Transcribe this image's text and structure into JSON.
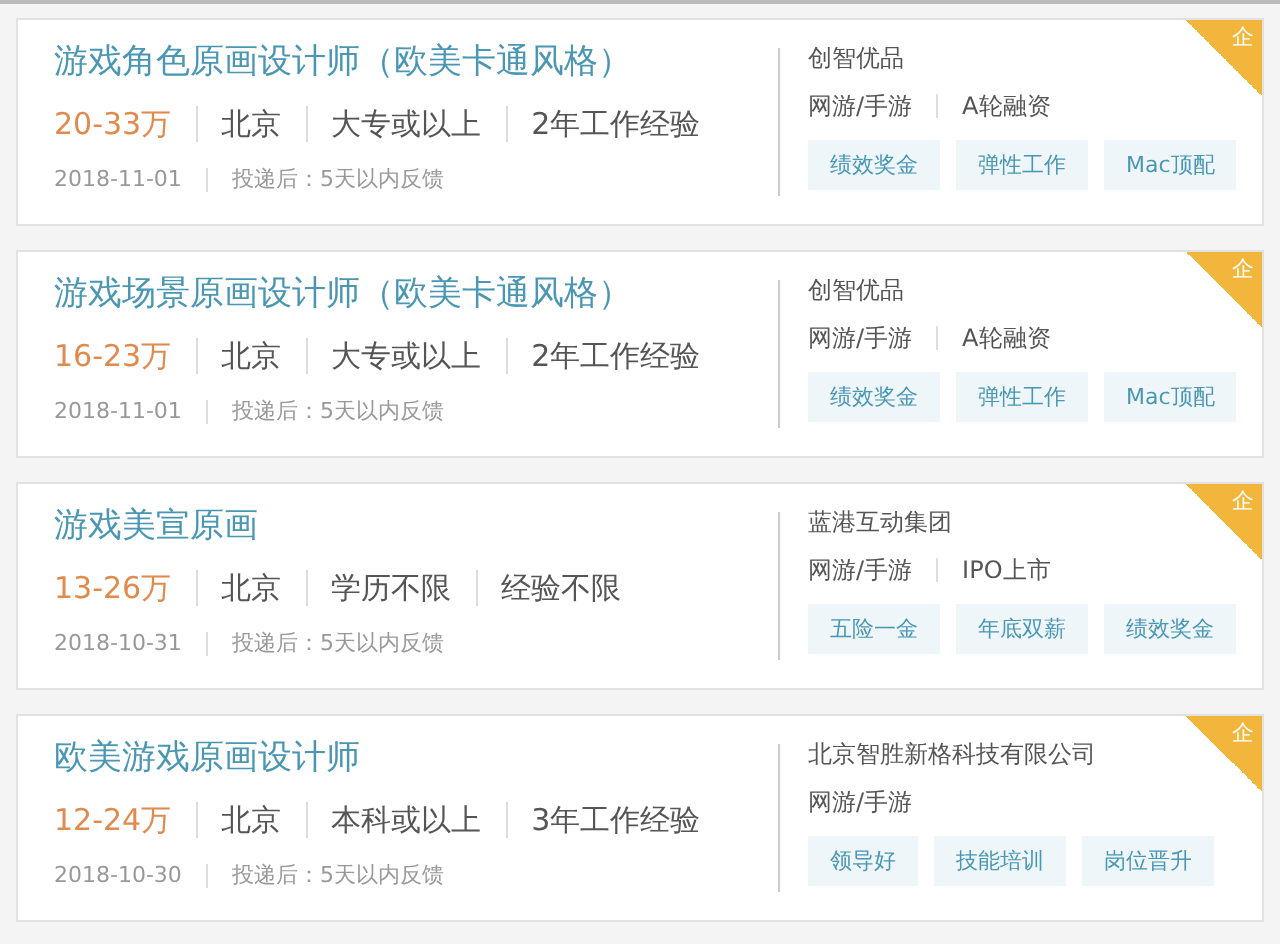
{
  "jobs": [
    {
      "title": "游戏角色原画设计师（欧美卡通风格）",
      "salary": "20-33万",
      "requirements": [
        "北京",
        "大专或以上",
        "2年工作经验"
      ],
      "date": "2018-11-01",
      "feedback": "投递后：5天以内反馈",
      "company": "创智优品",
      "industry": [
        "网游/手游",
        "A轮融资"
      ],
      "tags": [
        "绩效奖金",
        "弹性工作",
        "Mac顶配"
      ],
      "badge": "企"
    },
    {
      "title": "游戏场景原画设计师（欧美卡通风格）",
      "salary": "16-23万",
      "requirements": [
        "北京",
        "大专或以上",
        "2年工作经验"
      ],
      "date": "2018-11-01",
      "feedback": "投递后：5天以内反馈",
      "company": "创智优品",
      "industry": [
        "网游/手游",
        "A轮融资"
      ],
      "tags": [
        "绩效奖金",
        "弹性工作",
        "Mac顶配"
      ],
      "badge": "企"
    },
    {
      "title": "游戏美宣原画",
      "salary": "13-26万",
      "requirements": [
        "北京",
        "学历不限",
        "经验不限"
      ],
      "date": "2018-10-31",
      "feedback": "投递后：5天以内反馈",
      "company": "蓝港互动集团",
      "industry": [
        "网游/手游",
        "IPO上市"
      ],
      "tags": [
        "五险一金",
        "年底双薪",
        "绩效奖金"
      ],
      "badge": "企"
    },
    {
      "title": "欧美游戏原画设计师",
      "salary": "12-24万",
      "requirements": [
        "北京",
        "本科或以上",
        "3年工作经验"
      ],
      "date": "2018-10-30",
      "feedback": "投递后：5天以内反馈",
      "company": "北京智胜新格科技有限公司",
      "industry": [
        "网游/手游"
      ],
      "tags": [
        "领导好",
        "技能培训",
        "岗位晋升"
      ],
      "badge": "企"
    }
  ]
}
